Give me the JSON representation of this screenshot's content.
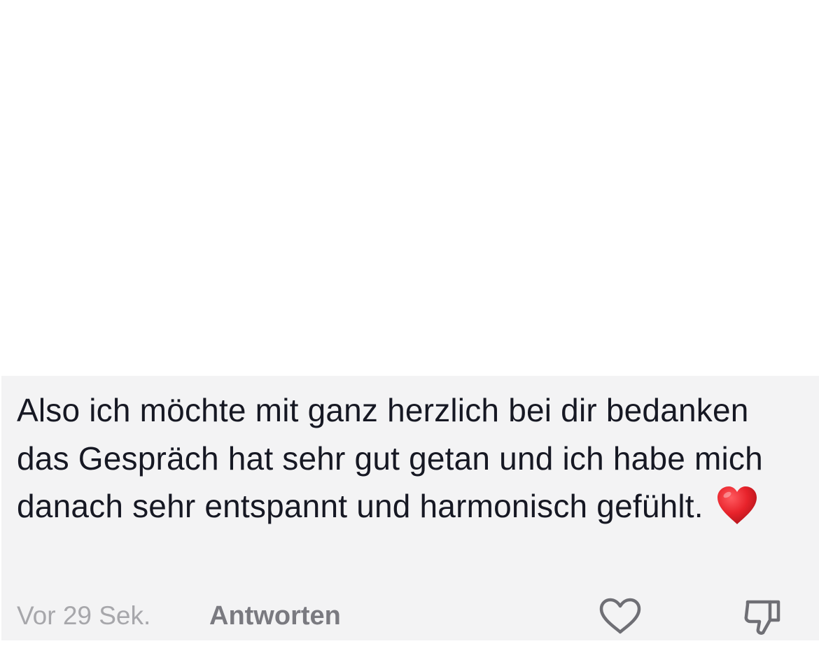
{
  "comment": {
    "text": "Also ich möchte mit ganz herzlich bei dir bedanken das Gespräch hat sehr gut getan und ich habe mich danach sehr entspannt und harmonisch gefühlt.",
    "emoji_icon": "red-heart-icon",
    "timestamp": "Vor 29 Sek.",
    "reply_label": "Antworten"
  },
  "actions": {
    "like_icon": "heart-outline-icon",
    "dislike_icon": "thumbs-down-icon"
  },
  "colors": {
    "card_background": "#f3f3f4",
    "text": "#161823",
    "muted_text": "#a7a7ab",
    "reply_text": "#7a7a80",
    "icon": "#6f6f75",
    "heart": "#e0242b"
  }
}
